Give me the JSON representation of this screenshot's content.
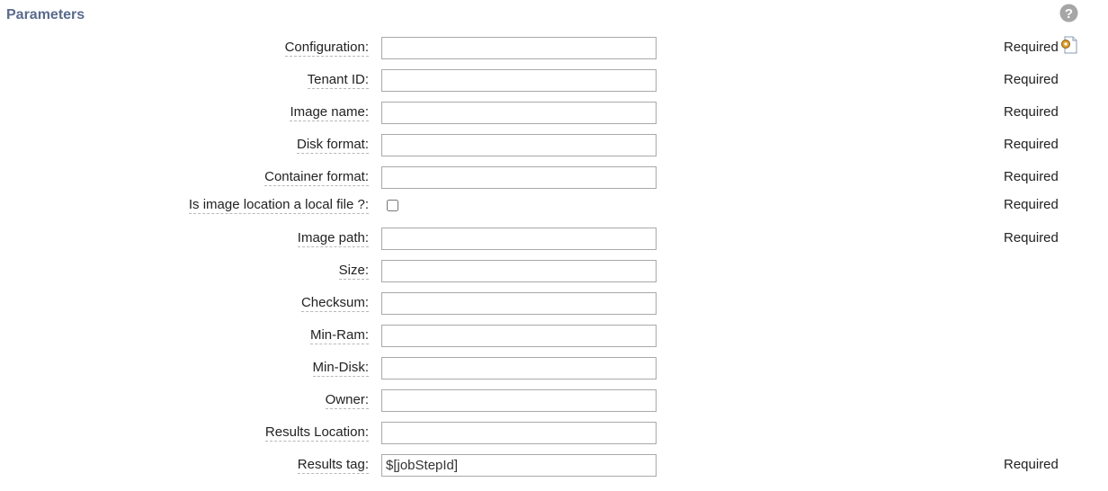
{
  "section": {
    "title": "Parameters",
    "help_icon": "question-mark-circle-icon",
    "config_icon": "page-gear-icon"
  },
  "parameters": [
    {
      "label": "Configuration:",
      "type": "text",
      "value": "",
      "required": "Required"
    },
    {
      "label": "Tenant ID:",
      "type": "text",
      "value": "",
      "required": "Required"
    },
    {
      "label": "Image name:",
      "type": "text",
      "value": "",
      "required": "Required"
    },
    {
      "label": "Disk format:",
      "type": "text",
      "value": "",
      "required": "Required"
    },
    {
      "label": "Container format:",
      "type": "text",
      "value": "",
      "required": "Required"
    },
    {
      "label": "Is image location a local file ?:",
      "type": "checkbox",
      "checked": false,
      "required": "Required"
    },
    {
      "label": "Image path:",
      "type": "text",
      "value": "",
      "required": "Required"
    },
    {
      "label": "Size:",
      "type": "text",
      "value": ""
    },
    {
      "label": "Checksum:",
      "type": "text",
      "value": ""
    },
    {
      "label": "Min-Ram:",
      "type": "text",
      "value": ""
    },
    {
      "label": "Min-Disk:",
      "type": "text",
      "value": ""
    },
    {
      "label": "Owner:",
      "type": "text",
      "value": ""
    },
    {
      "label": "Results Location:",
      "type": "text",
      "value": ""
    },
    {
      "label": "Results tag:",
      "type": "text",
      "value": "$[jobStepId]",
      "required": "Required"
    }
  ],
  "colors": {
    "title": "#5a6b8c",
    "input_border": "#a9a9a9",
    "help_icon": "#a6a6a6"
  }
}
